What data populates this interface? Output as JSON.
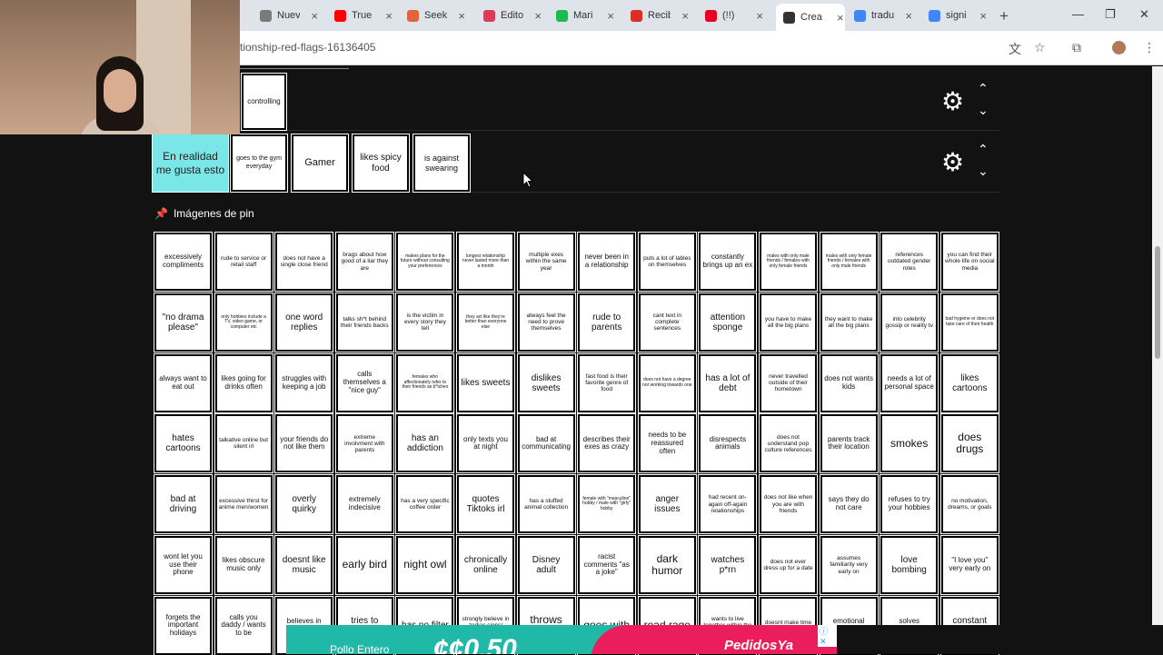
{
  "browser": {
    "tabs": [
      {
        "title": "Nuev",
        "color": "#7a7a7a",
        "active": false
      },
      {
        "title": "True",
        "color": "#ff0000",
        "active": false
      },
      {
        "title": "Seek",
        "color": "#e0643b",
        "active": false
      },
      {
        "title": "Edito",
        "color": "#d93b5b",
        "active": false
      },
      {
        "title": "Mari",
        "color": "#1db954",
        "active": false
      },
      {
        "title": "Recib",
        "color": "#d93025",
        "active": false
      },
      {
        "title": "(!!)",
        "color": "#e60023",
        "active": false
      },
      {
        "title": "Crea",
        "color": "#333333",
        "active": true
      },
      {
        "title": "tradu",
        "color": "#4285f4",
        "active": false
      },
      {
        "title": "signi",
        "color": "#4285f4",
        "active": false
      }
    ],
    "url": "tionship-red-flags-16136405",
    "new_tab_icon": "+",
    "window_controls": [
      "—",
      "❐",
      "✕"
    ]
  },
  "selected_rows": [
    {
      "cards": [
        {
          "text": "controlling",
          "liked": false
        }
      ]
    },
    {
      "cards": [
        {
          "text": "En realidad me gusta esto",
          "liked": true
        },
        {
          "text": "goes to the gym everyday",
          "liked": false
        },
        {
          "text": "Gamer",
          "liked": false
        },
        {
          "text": "likes spicy food",
          "liked": false
        },
        {
          "text": "is against swearing",
          "liked": false
        }
      ]
    }
  ],
  "section_title": "Imágenes de pin",
  "grid_items": [
    [
      "excessively compliments",
      "rude to service or retail staff",
      "does not have a single close friend",
      "brags about how good of a liar they are",
      "makes plans for the future without consulting your preferences",
      "longest relationship never lasted more than a month",
      "multiple exes within the same year",
      "never been in a relationship",
      "puts a lot of lables on themselves",
      "constantly brings up an ex",
      "males with only male friends / females with only female friends",
      "males with only female friends / females with only male friends",
      "references outdated gender roles",
      "you can find their whole life on social media"
    ],
    [
      "\"no drama please\"",
      "only hobbies include a TV, video game, or computer etc",
      "one word replies",
      "talks sh*t behind their friends backs",
      "is the victim in every story they tell",
      "they act like they're better than everyone else",
      "always feel the need to prove themselves",
      "rude to parents",
      "cant text in complete sentences",
      "attention sponge",
      "you have to make all the big plans",
      "they want to make all the big plans",
      "into celebrity gossip or reality tv",
      "bad hygeine or does not take care of their health"
    ],
    [
      "always want to eat out",
      "likes going for drinks often",
      "struggles with keeping a job",
      "calls themselves a \"nice guy\"",
      "females who affectionately refer to their friends as b*tches",
      "likes sweets",
      "dislikes sweets",
      "fast food is their favorite genre of food",
      "does not have a degree nor working towards one",
      "has a lot of debt",
      "never travelled outside of their hometown",
      "does not wants kids",
      "needs a lot of personal space",
      "likes cartoons"
    ],
    [
      "hates cartoons",
      "talkative online but silent irl",
      "your friends do not like them",
      "extreme involvment with parents",
      "has an addiction",
      "only texts you at night",
      "bad at communicating",
      "describes their exes as crazy",
      "needs to be reassured often",
      "disrespects animals",
      "does not understand pop culture references",
      "parents track their location",
      "smokes",
      "does drugs"
    ],
    [
      "bad at driving",
      "excessive thirst for anime men/women",
      "overly quirky",
      "extremely indecisive",
      "has a very specific coffee order",
      "quotes Tiktoks irl",
      "has a stuffed animal collection",
      "female with \"masculine\" hobby / male with \"girly\" hobby",
      "anger issues",
      "had recent on-again off-again relationships",
      "does not like when you are with friends",
      "says they do not care",
      "refuses to try your hobbies",
      "no motivation, dreams, or goals"
    ],
    [
      "wont let you use their phone",
      "likes obscure music only",
      "doesnt like music",
      "early bird",
      "night owl",
      "chronically online",
      "Disney adult",
      "racist comments \"as a joke\"",
      "dark humor",
      "watches p*rn",
      "does not ever dress up for a date",
      "assumes familiarity very early on",
      "love bombing",
      "\"I love you\" very early on"
    ],
    [
      "forgets the important holidays",
      "calls you daddy / wants to be",
      "believes in conspiracy",
      "tries to convert",
      "has no filter",
      "strongly believe in zodiac signs/ horoscopes",
      "throws away",
      "goes with",
      "road rage",
      "wants to live together within the first year",
      "doesnt make time in their schedule",
      "emotional outbursts",
      "solves disagreements",
      "constant self-"
    ]
  ],
  "ad": {
    "line1": "Pollo Entero",
    "price": "¢¢0.50",
    "brand": "PedidosYa",
    "badge": "ⓘ ✕"
  },
  "colors": {
    "liked_card": "#7be6e8",
    "background": "#121212",
    "ad_green": "#20b8a6",
    "ad_pink": "#ea1d5d"
  }
}
